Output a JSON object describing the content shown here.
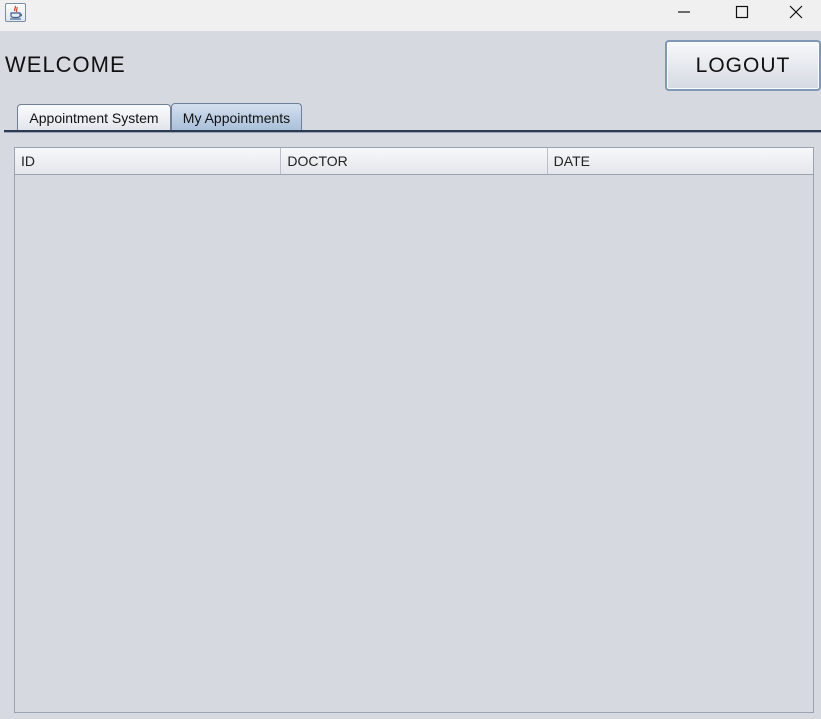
{
  "window": {
    "icon": "java-icon",
    "controls": [
      "minimize-icon",
      "maximize-icon",
      "close-icon"
    ]
  },
  "header": {
    "welcome": "WELCOME",
    "logout_label": "LOGOUT"
  },
  "tabs": [
    {
      "label": "Appointment System",
      "selected": false
    },
    {
      "label": "My Appointments",
      "selected": true
    }
  ],
  "table": {
    "columns": [
      "ID",
      "DOCTOR",
      "DATE"
    ],
    "rows": []
  },
  "colors": {
    "background": "#d6d9e0",
    "selected_tab": "#a9bfd9",
    "button_border": "#7f98b6"
  }
}
